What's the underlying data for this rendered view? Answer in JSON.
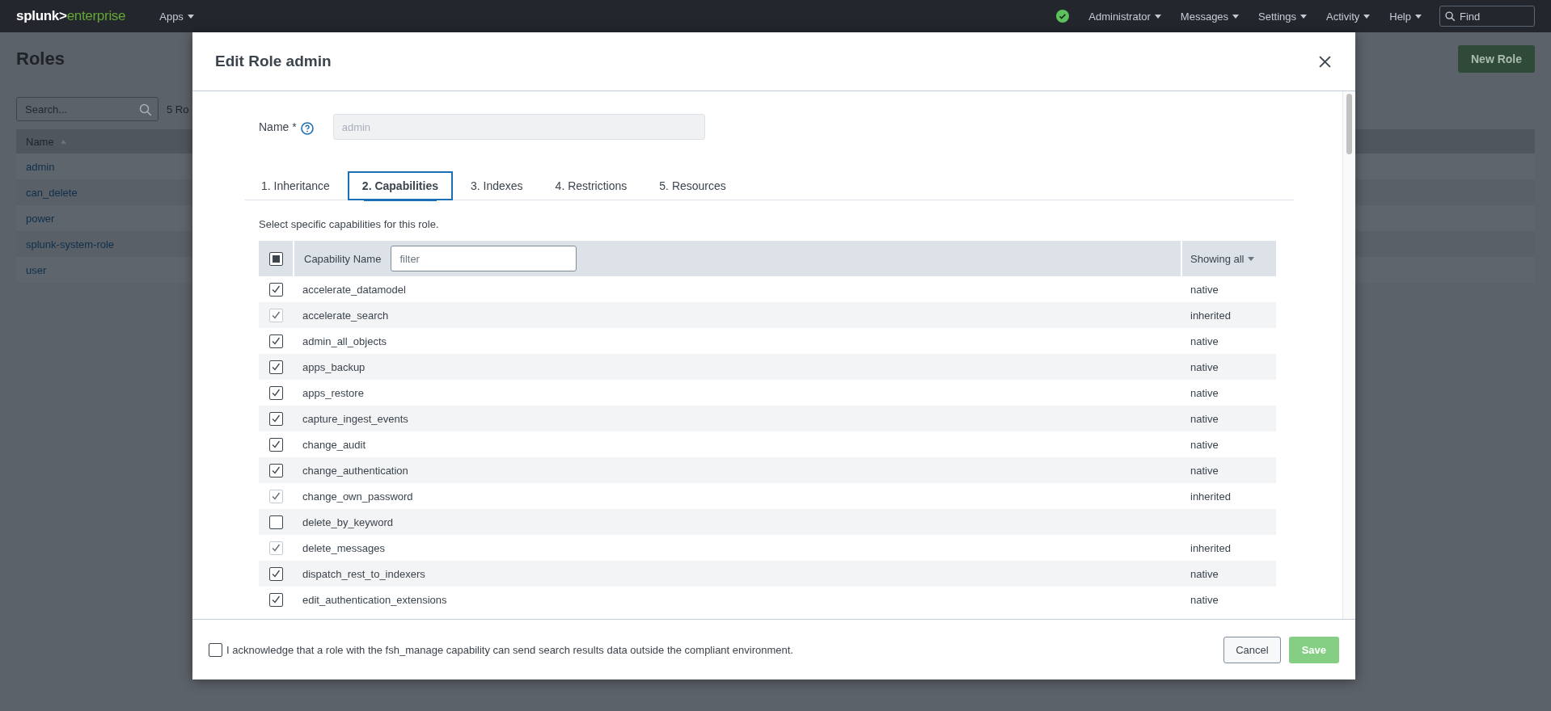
{
  "top_bar": {
    "logo": {
      "brand": "splunk>",
      "product": "enterprise"
    },
    "apps_menu": "Apps",
    "status_ok": true,
    "menus": [
      "Administrator",
      "Messages",
      "Settings",
      "Activity",
      "Help"
    ],
    "find": {
      "placeholder": "Find"
    }
  },
  "page": {
    "title": "Roles",
    "new_button": "New Role",
    "search": {
      "placeholder": "Search..."
    },
    "count": "5 Ro",
    "table": {
      "column": "Name",
      "rows": [
        "admin",
        "can_delete",
        "power",
        "splunk-system-role",
        "user"
      ]
    }
  },
  "dialog": {
    "title": "Edit Role admin",
    "name_label": "Name *",
    "name_value": "admin",
    "tabs": [
      {
        "label": "1. Inheritance",
        "selected": false
      },
      {
        "label": "2. Capabilities",
        "selected": true
      },
      {
        "label": "3. Indexes",
        "selected": false
      },
      {
        "label": "4. Restrictions",
        "selected": false
      },
      {
        "label": "5. Resources",
        "selected": false
      }
    ],
    "description": "Select specific capabilities for this role.",
    "table": {
      "select_all_partial": true,
      "column": "Capability Name",
      "filter": {
        "placeholder": "filter"
      },
      "source_column": "Showing all",
      "rows": [
        {
          "name": "accelerate_datamodel",
          "checked": true,
          "disabled": false,
          "source": "native"
        },
        {
          "name": "accelerate_search",
          "checked": true,
          "disabled": true,
          "source": "inherited"
        },
        {
          "name": "admin_all_objects",
          "checked": true,
          "disabled": false,
          "source": "native"
        },
        {
          "name": "apps_backup",
          "checked": true,
          "disabled": false,
          "source": "native"
        },
        {
          "name": "apps_restore",
          "checked": true,
          "disabled": false,
          "source": "native"
        },
        {
          "name": "capture_ingest_events",
          "checked": true,
          "disabled": false,
          "source": "native"
        },
        {
          "name": "change_audit",
          "checked": true,
          "disabled": false,
          "source": "native"
        },
        {
          "name": "change_authentication",
          "checked": true,
          "disabled": false,
          "source": "native"
        },
        {
          "name": "change_own_password",
          "checked": true,
          "disabled": true,
          "source": "inherited"
        },
        {
          "name": "delete_by_keyword",
          "checked": false,
          "disabled": false
        },
        {
          "name": "delete_messages",
          "checked": true,
          "disabled": true,
          "source": "inherited"
        },
        {
          "name": "dispatch_rest_to_indexers",
          "checked": true,
          "disabled": false,
          "source": "native"
        },
        {
          "name": "edit_authentication_extensions",
          "checked": true,
          "disabled": false,
          "source": "native"
        }
      ]
    },
    "acknowledge": {
      "checked": false,
      "text": "I acknowledge that a role with the fsh_manage capability can send search results data outside the compliant environment."
    },
    "buttons": {
      "cancel": "Cancel",
      "save": "Save",
      "save_disabled": true
    }
  }
}
